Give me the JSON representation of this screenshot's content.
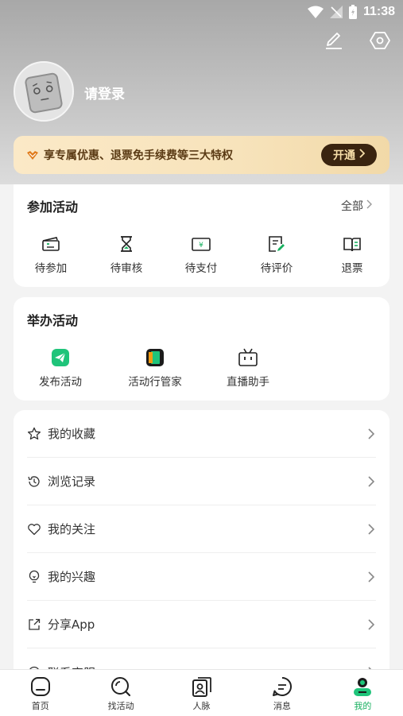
{
  "status_bar": {
    "time": "11:38"
  },
  "profile": {
    "login_text": "请登录"
  },
  "vip_banner": {
    "text": "享专属优惠、退票免手续费等三大特权",
    "button_label": "开通"
  },
  "join_activity": {
    "title": "参加活动",
    "more_label": "全部",
    "items": [
      {
        "label": "待参加",
        "icon": "ticket-icon"
      },
      {
        "label": "待审核",
        "icon": "hourglass-icon"
      },
      {
        "label": "待支付",
        "icon": "payment-icon"
      },
      {
        "label": "待评价",
        "icon": "review-icon"
      },
      {
        "label": "退票",
        "icon": "refund-icon"
      }
    ]
  },
  "host_activity": {
    "title": "举办活动",
    "items": [
      {
        "label": "发布活动",
        "icon": "publish-icon"
      },
      {
        "label": "活动行管家",
        "icon": "manager-app-icon"
      },
      {
        "label": "直播助手",
        "icon": "tv-icon"
      }
    ]
  },
  "menu_list": [
    {
      "label": "我的收藏",
      "icon": "star-icon"
    },
    {
      "label": "浏览记录",
      "icon": "history-icon"
    },
    {
      "label": "我的关注",
      "icon": "heart-icon"
    },
    {
      "label": "我的兴趣",
      "icon": "bulb-icon"
    },
    {
      "label": "分享App",
      "icon": "share-icon"
    },
    {
      "label": "联系客服",
      "icon": "service-icon"
    }
  ],
  "tabbar": [
    {
      "label": "首页",
      "icon": "home-icon"
    },
    {
      "label": "找活动",
      "icon": "search-activity-icon"
    },
    {
      "label": "人脉",
      "icon": "contacts-icon"
    },
    {
      "label": "消息",
      "icon": "message-icon"
    },
    {
      "label": "我的",
      "icon": "profile-icon",
      "active": true
    }
  ],
  "colors": {
    "accent": "#17b05f",
    "vip_button": "#3a2410",
    "vip_text": "#5a3a14"
  }
}
